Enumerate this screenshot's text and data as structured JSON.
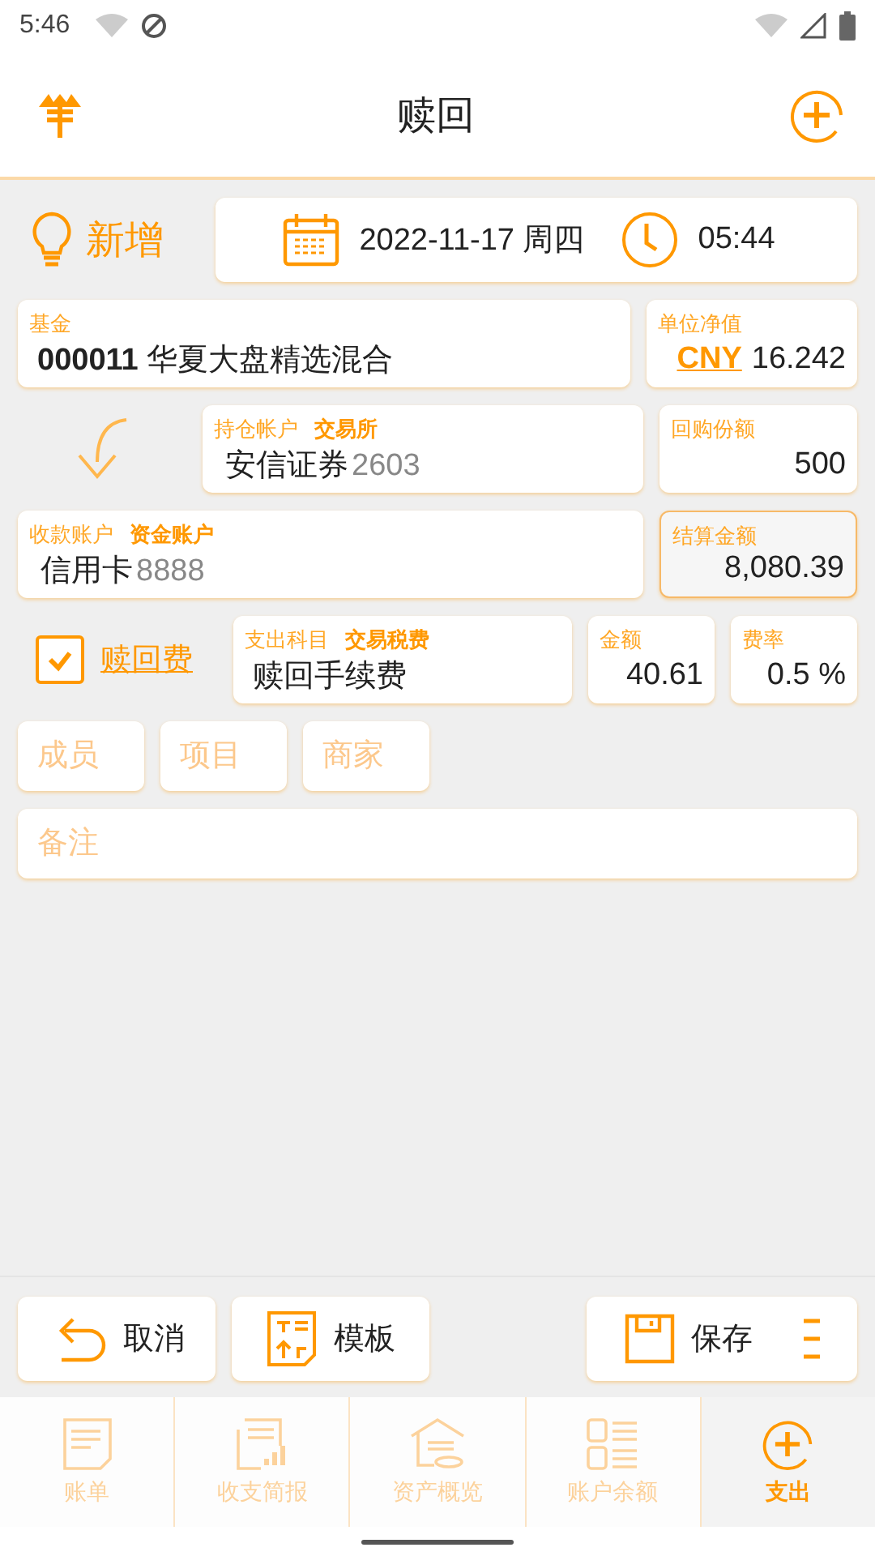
{
  "status_bar": {
    "time": "5:46"
  },
  "header": {
    "title": "赎回"
  },
  "mode_label": "新增",
  "date": "2022-11-17 周四",
  "time": "05:44",
  "fund": {
    "label": "基金",
    "text": "**000011** 华夏大盘精选混合"
  },
  "nav": {
    "label": "单位净值",
    "currency": "CNY",
    "value": "16.242"
  },
  "holding_account": {
    "label": "持仓帐户",
    "tag": "交易所",
    "name": "安信证券",
    "suffix": "2603"
  },
  "shares": {
    "label": "回购份额",
    "value": "500"
  },
  "receiving_account": {
    "label": "收款账户",
    "tag": "资金账户",
    "name": "信用卡",
    "suffix": "8888"
  },
  "settlement": {
    "label": "结算金额",
    "value": "8,080.39"
  },
  "fee": {
    "checked": true,
    "label": "赎回费",
    "category_label": "支出科目",
    "category_tag": "交易税费",
    "category_value": "赎回手续费",
    "amount_label": "金额",
    "amount": "40.61",
    "rate_label": "费率",
    "rate": "0.5 %"
  },
  "tags": [
    {
      "placeholder": "成员"
    },
    {
      "placeholder": "项目"
    },
    {
      "placeholder": "商家"
    }
  ],
  "note": {
    "placeholder": "备注"
  },
  "actions": [
    {
      "kind": "cancel",
      "label": "取消"
    },
    {
      "kind": "template",
      "label": "模板"
    },
    {
      "kind": "save",
      "label": "保存"
    }
  ],
  "tabs": [
    {
      "kind": "bill",
      "label": "账单",
      "selected": false
    },
    {
      "kind": "report",
      "label": "收支简报",
      "selected": false
    },
    {
      "kind": "assets",
      "label": "资产概览",
      "selected": false
    },
    {
      "kind": "balance",
      "label": "账户余额",
      "selected": false
    },
    {
      "kind": "expense",
      "label": "支出",
      "selected": true
    }
  ]
}
